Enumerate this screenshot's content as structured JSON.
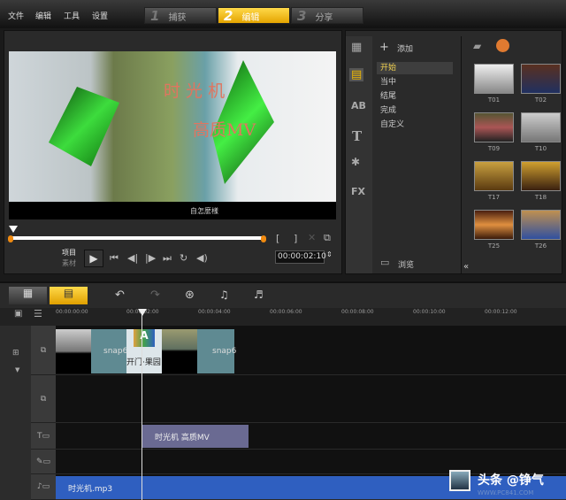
{
  "menu": [
    "文件",
    "编辑",
    "工具",
    "设置"
  ],
  "steps": [
    {
      "num": "1",
      "label": "捕获"
    },
    {
      "num": "2",
      "label": "编辑",
      "active": true
    },
    {
      "num": "3",
      "label": "分享"
    }
  ],
  "preview": {
    "title_line1": "时 光 机",
    "title_line2": "高质MV",
    "subtitle": "自怎麼樣",
    "project_label": "项目",
    "clip_label": "素材",
    "timecode": "00:00:02:10"
  },
  "library": {
    "add_label": "添加",
    "browse_label": "浏览",
    "categories": [
      "开始",
      "当中",
      "结尾",
      "完成",
      "自定义"
    ],
    "selected_category": "开始",
    "thumbnails": [
      "T01",
      "T02",
      "T09",
      "T10",
      "T17",
      "T18",
      "T25",
      "T26"
    ]
  },
  "timeline": {
    "ruler": [
      "00:00:00:00",
      "00:00:02:00",
      "00:00:04:00",
      "00:00:06:00",
      "00:00:08:00",
      "00:00:10:00",
      "00:00:12:00"
    ],
    "clips": {
      "snap_a": "snap6",
      "snap_b": "snap6",
      "title_clip_caption": "开门·果园",
      "title_clip": "时光机 高质MV",
      "music_clip": "时光机.mp3"
    }
  },
  "watermark": {
    "text": "头条 @铮气",
    "url": "WWW.PC841.COM"
  },
  "colors": {
    "accent": "#f0b800",
    "title_clip": "#6a6a92",
    "music_clip": "#2f5fc0",
    "snap_clip": "#5f8a92"
  }
}
